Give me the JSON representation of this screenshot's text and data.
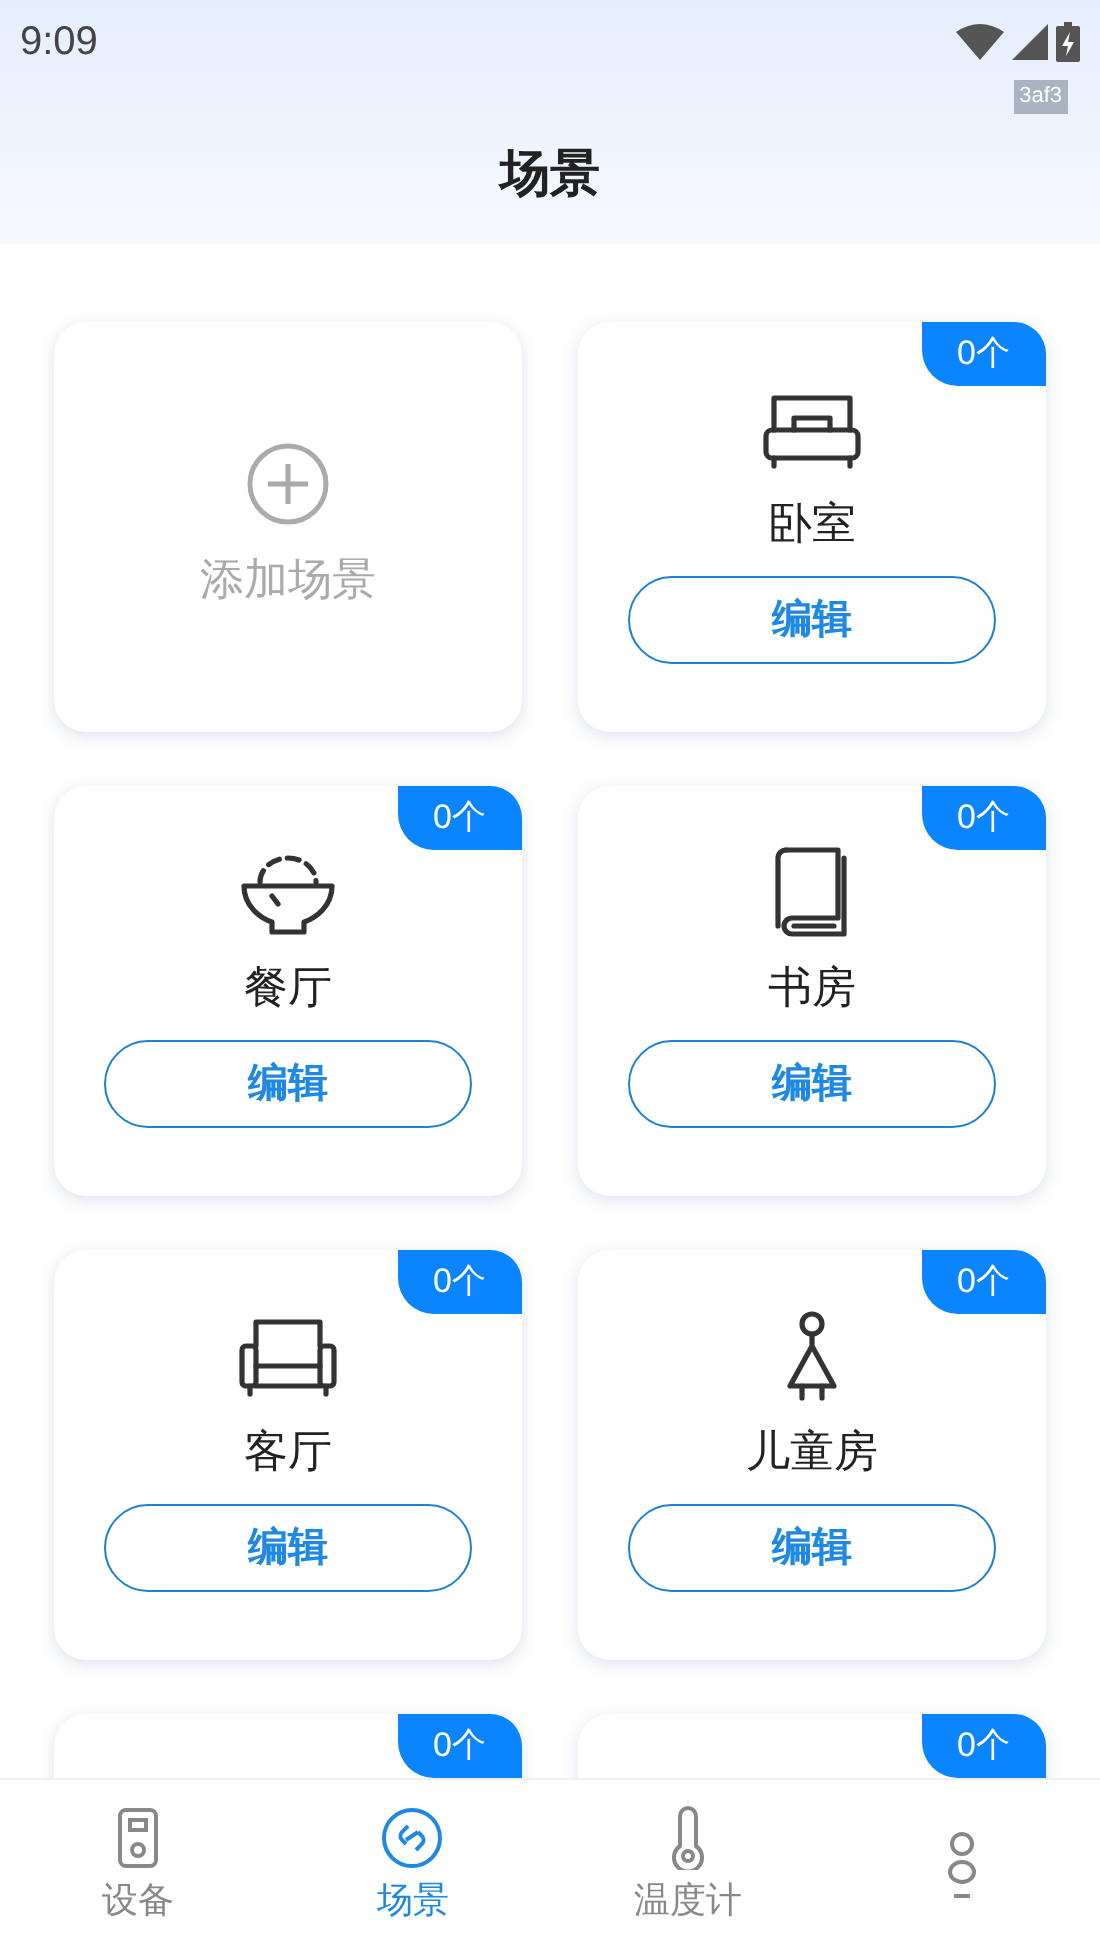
{
  "status_bar": {
    "time": "9:09",
    "tag": "3af3"
  },
  "header": {
    "title": "场景"
  },
  "add_card": {
    "label": "添加场景"
  },
  "scenes": [
    {
      "name": "卧室",
      "count": "0个",
      "button": "编辑"
    },
    {
      "name": "餐厅",
      "count": "0个",
      "button": "编辑"
    },
    {
      "name": "书房",
      "count": "0个",
      "button": "编辑"
    },
    {
      "name": "客厅",
      "count": "0个",
      "button": "编辑"
    },
    {
      "name": "儿童房",
      "count": "0个",
      "button": "编辑"
    },
    {
      "count": "0个"
    },
    {
      "count": "0个"
    }
  ],
  "bottom_nav": [
    {
      "label": "设备",
      "selected": false
    },
    {
      "label": "场景",
      "selected": true
    },
    {
      "label": "温度计",
      "selected": false
    },
    {
      "selected": false
    }
  ]
}
